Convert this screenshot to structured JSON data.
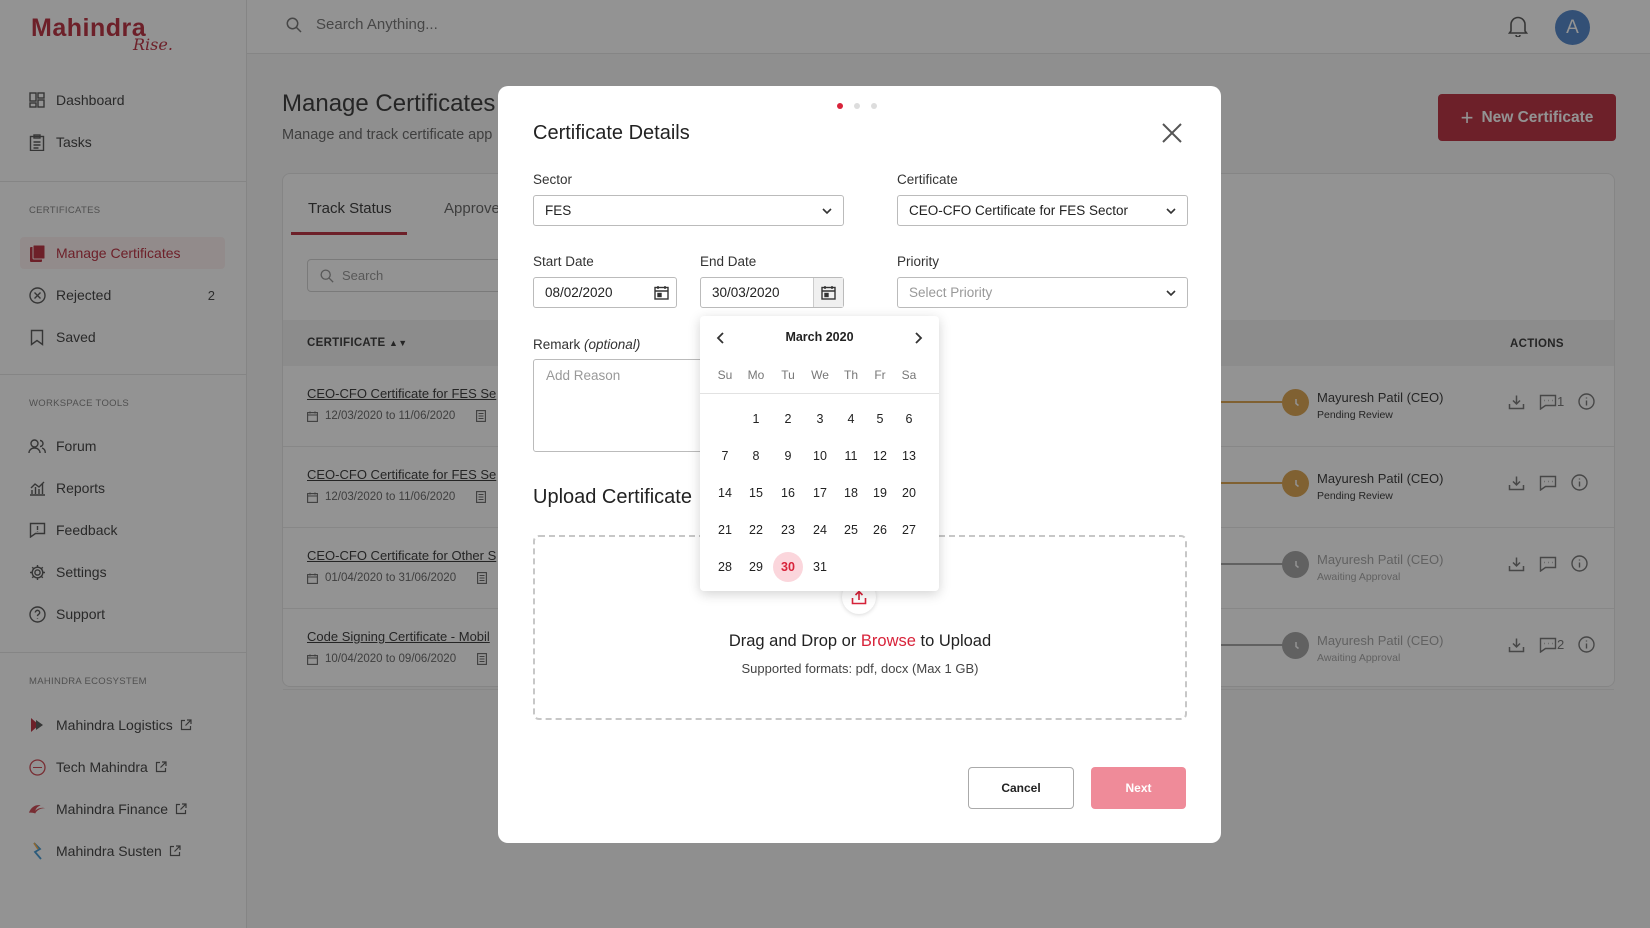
{
  "brand": {
    "name": "Mahindra",
    "tagline": "Rise."
  },
  "topbar": {
    "search_placeholder": "Search Anything...",
    "avatar_initial": "A"
  },
  "sidebar": {
    "nav": [
      {
        "label": "Dashboard",
        "icon": "dashboard-icon"
      },
      {
        "label": "Tasks",
        "icon": "tasks-icon"
      }
    ],
    "certificates_heading": "CERTIFICATES",
    "certificates": [
      {
        "label": "Manage Certificates",
        "icon": "certificate-icon",
        "active": true
      },
      {
        "label": "Rejected",
        "icon": "rejected-icon",
        "count": "2"
      },
      {
        "label": "Saved",
        "icon": "bookmark-icon"
      }
    ],
    "workspace_heading": "WORKSPACE TOOLS",
    "workspace": [
      {
        "label": "Forum",
        "icon": "users-icon"
      },
      {
        "label": "Reports",
        "icon": "reports-icon"
      },
      {
        "label": "Feedback",
        "icon": "feedback-icon"
      },
      {
        "label": "Settings",
        "icon": "gear-icon"
      },
      {
        "label": "Support",
        "icon": "help-icon"
      }
    ],
    "ecosystem_heading": "MAHINDRA ECOSYSTEM",
    "ecosystem": [
      {
        "label": "Mahindra Logistics"
      },
      {
        "label": "Tech Mahindra"
      },
      {
        "label": "Mahindra Finance"
      },
      {
        "label": "Mahindra Susten"
      }
    ]
  },
  "page": {
    "title": "Manage Certificates",
    "subtitle": "Manage and track certificate app",
    "new_button": "New Certificate",
    "tabs": [
      "Track Status",
      "Approve"
    ],
    "search_placeholder": "Search",
    "columns": {
      "certificate": "CERTIFICATE",
      "actions": "ACTIONS"
    },
    "rows": [
      {
        "name": "CEO-CFO Certificate for FES Se",
        "dates": "12/03/2020 to 11/06/2020",
        "approver": "Mayuresh Patil (CEO)",
        "status": "Pending Review",
        "comments": "1"
      },
      {
        "name": "CEO-CFO Certificate for FES Se",
        "dates": "12/03/2020 to 11/06/2020",
        "approver": "Mayuresh Patil (CEO)",
        "status": "Pending Review",
        "comments": ""
      },
      {
        "name": "CEO-CFO Certificate for Other S",
        "dates": "01/04/2020 to 31/06/2020",
        "approver": "Mayuresh Patil (CEO)",
        "status": "Awaiting Approval",
        "comments": ""
      },
      {
        "name": "Code Signing Certificate - Mobil",
        "dates": "10/04/2020 to 09/06/2020",
        "approver": "Mayuresh Patil (CEO)",
        "status": "Awaiting Approval",
        "comments": "2"
      }
    ]
  },
  "modal": {
    "title": "Certificate Details",
    "step_current": 1,
    "step_total": 3,
    "sector": {
      "label": "Sector",
      "value": "FES"
    },
    "certificate": {
      "label": "Certificate",
      "value": "CEO-CFO Certificate for FES Sector"
    },
    "start_date": {
      "label": "Start Date",
      "value": "08/02/2020"
    },
    "end_date": {
      "label": "End Date",
      "value": "30/03/2020"
    },
    "priority": {
      "label": "Priority",
      "placeholder": "Select Priority"
    },
    "remark": {
      "label": "Remark",
      "optional": "(optional)",
      "placeholder": "Add Reason"
    },
    "upload_title": "Upload Certificate",
    "drop_text_1": "Drag and Drop or",
    "drop_browse": "Browse",
    "drop_text_2": "to Upload",
    "formats": "Supported formats: pdf, docx (Max 1 GB)",
    "cancel": "Cancel",
    "next": "Next"
  },
  "calendar": {
    "month_label": "March 2020",
    "weekdays": [
      "Su",
      "Mo",
      "Tu",
      "We",
      "Th",
      "Fr",
      "Sa"
    ],
    "first_weekday_index": 1,
    "days_in_month": 31,
    "selected_day": 30
  },
  "colors": {
    "brand": "#b3182b",
    "accent": "#d8233a",
    "pending": "#d99a3c",
    "awaiting": "#9a9a9a",
    "next_disabled": "#ef8b99"
  }
}
